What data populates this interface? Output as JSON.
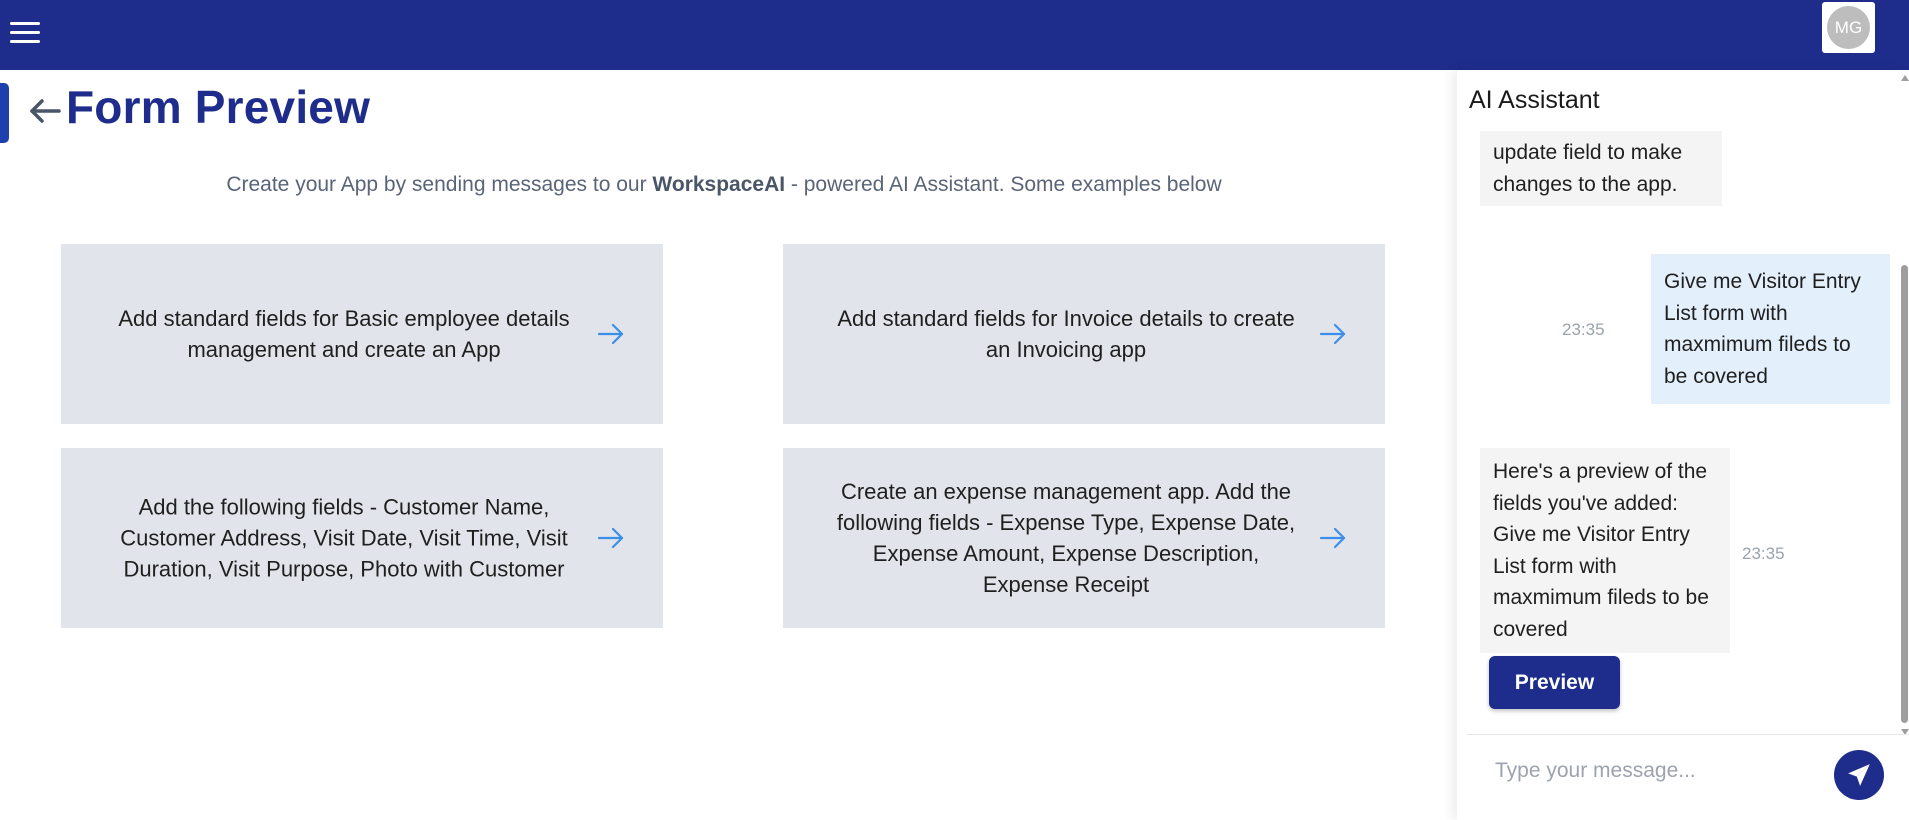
{
  "header": {
    "avatar_initials": "MG",
    "background_color": "#1e2d8c"
  },
  "page": {
    "title": "Form Preview",
    "subtitle": {
      "prefix": "Create your App by sending messages to our ",
      "brand": "WorkspaceAI",
      "suffix": " - powered AI Assistant. Some examples below"
    }
  },
  "examples": [
    {
      "text": "Add standard fields for Basic employee details management and create an App"
    },
    {
      "text": "Add standard fields for Invoice details to create an Invoicing app"
    },
    {
      "text": "Add the following fields - Customer Name, Customer Address, Visit Date, Visit Time, Visit Duration, Visit Purpose, Photo with Customer"
    },
    {
      "text": "Create an expense management app. Add the following fields - Expense Type, Expense Date, Expense Amount, Expense Description, Expense Receipt"
    }
  ],
  "assistant": {
    "title": "AI Assistant",
    "messages": [
      {
        "role": "bot",
        "text": "update field to make changes to the app."
      },
      {
        "role": "user",
        "text": "Give me Visitor Entry List form with maxmimum fileds to be covered",
        "time": "23:35"
      },
      {
        "role": "bot",
        "text": "Here's a preview of the fields you've added: Give me Visitor Entry List form with maxmimum fileds to be covered",
        "time": "23:35"
      }
    ],
    "preview_label": "Preview",
    "input_placeholder": "Type your message...",
    "input_value": ""
  },
  "icons": {
    "menu": "hamburger-icon",
    "back": "arrow-left-icon",
    "example_arrow": "arrow-right-icon",
    "send": "paper-plane-icon"
  },
  "colors": {
    "primary": "#1e2d8c",
    "card_background": "#e1e4ea",
    "user_bubble": "#e3f0fc",
    "bot_bubble": "#f4f4f4",
    "arrow": "#3b8fe8"
  }
}
